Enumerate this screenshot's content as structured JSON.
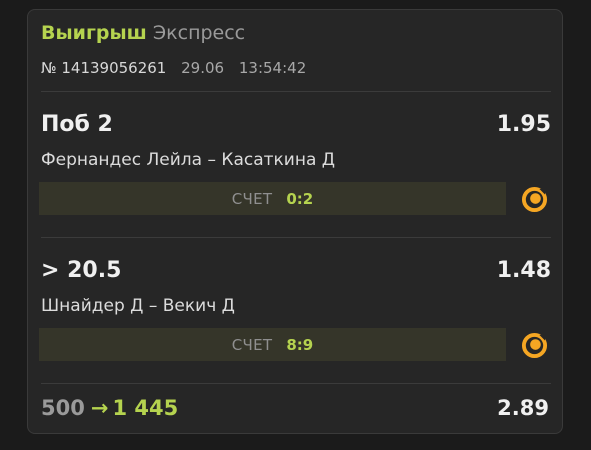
{
  "header": {
    "status": "Выигрыш",
    "type": "Экспресс",
    "number": "№ 14139056261",
    "date": "29.06",
    "time": "13:54:42"
  },
  "bets": [
    {
      "pick": "Поб 2",
      "odds": "1.95",
      "event": "Фернандес Лейла – Касаткина Д",
      "score_label": "СЧЕТ",
      "score": "0:2"
    },
    {
      "pick": "> 20.5",
      "odds": "1.48",
      "event": "Шнайдер Д – Векич Д",
      "score_label": "СЧЕТ",
      "score": "8:9"
    }
  ],
  "footer": {
    "stake": "500",
    "arrow": "→",
    "payout": "1 445",
    "total_odds": "2.89"
  },
  "colors": {
    "win_accent": "#b5d34f",
    "live_icon": "#f5a623",
    "card_bg": "#262626"
  },
  "icons": [
    "live-status-icon",
    "arrow-right-icon"
  ]
}
